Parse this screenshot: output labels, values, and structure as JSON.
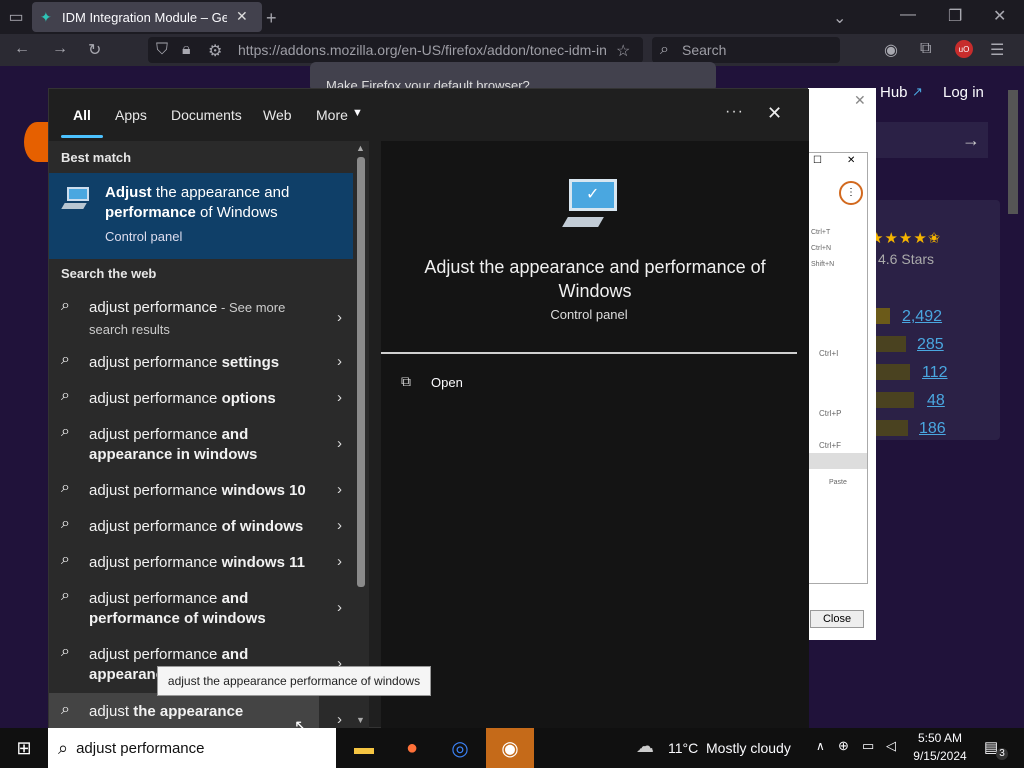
{
  "browser": {
    "tab_title": "IDM Integration Module – Get th",
    "url": "https://addons.mozilla.org/en-US/firefox/addon/tonec-idm-in",
    "search_placeholder": "Search",
    "notification": "Make Firefox your default browser?"
  },
  "page": {
    "hub_link": "Hub",
    "login_link": "Log in",
    "stars_label": "4.6 Stars",
    "rating_counts": [
      "2,492",
      "285",
      "112",
      "48",
      "186"
    ],
    "close_button": "Close",
    "menu_shortcuts": [
      "Ctrl+T",
      "Ctrl+N",
      "Shift+N",
      "Ctrl+I",
      "Ctrl+P",
      "Ctrl+F",
      "Paste"
    ]
  },
  "start_menu": {
    "tabs": [
      "All",
      "Apps",
      "Documents",
      "Web",
      "More"
    ],
    "more_dots": "···",
    "best_match_label": "Best match",
    "best_match": {
      "title_bold": "Adjust",
      "title_rest_1": " the appearance and",
      "title_bold_2": "performance",
      "title_rest_2": " of Windows",
      "subtitle": "Control panel"
    },
    "search_web_label": "Search the web",
    "results": [
      {
        "normal": "adjust performance",
        "bold": "",
        "extra": " - See more",
        "line2": "search results"
      },
      {
        "normal": "adjust performance ",
        "bold": "settings",
        "extra": "",
        "line2": ""
      },
      {
        "normal": "adjust performance ",
        "bold": "options",
        "extra": "",
        "line2": ""
      },
      {
        "normal": "adjust performance ",
        "bold": "and",
        "extra": "",
        "line2": "appearance in windows"
      },
      {
        "normal": "adjust performance ",
        "bold": "windows 10",
        "extra": "",
        "line2": ""
      },
      {
        "normal": "adjust performance ",
        "bold": "of windows",
        "extra": "",
        "line2": ""
      },
      {
        "normal": "adjust performance ",
        "bold": "windows 11",
        "extra": "",
        "line2": ""
      },
      {
        "normal": "adjust performance ",
        "bold": "and",
        "extra": "",
        "line2": "performance of windows"
      },
      {
        "normal": "adjust performance ",
        "bold": "and",
        "extra": "",
        "line2": "appearance"
      },
      {
        "normal": "adjust ",
        "bold": "the appearance",
        "extra": "",
        "line2": ""
      }
    ],
    "tooltip": "adjust the appearance performance of windows",
    "preview": {
      "title": "Adjust the appearance and performance of Windows",
      "subtitle": "Control panel",
      "open_label": "Open"
    }
  },
  "taskbar": {
    "search_value": "adjust performance",
    "weather": "11°C  Mostly cloudy",
    "time": "5:50 AM",
    "date": "9/15/2024",
    "notification_count": "3"
  },
  "colors": {
    "accent": "#0f3f68",
    "link": "#4aa7e0"
  }
}
